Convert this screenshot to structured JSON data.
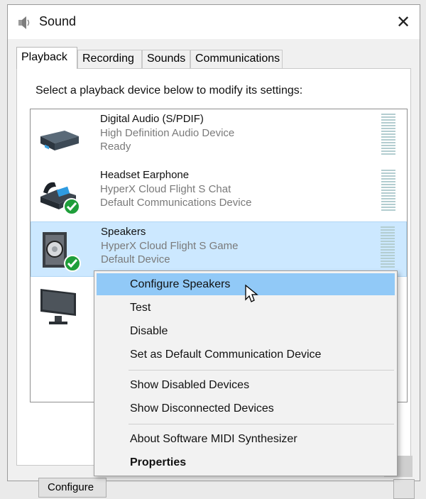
{
  "window": {
    "title": "Sound",
    "close_glyph": "✕"
  },
  "tabs": [
    {
      "label": "Playback",
      "active": true
    },
    {
      "label": "Recording",
      "active": false
    },
    {
      "label": "Sounds",
      "active": false
    },
    {
      "label": "Communications",
      "active": false
    }
  ],
  "instruction": "Select a playback device below to modify its settings:",
  "devices": [
    {
      "name": "Digital Audio (S/PDIF)",
      "driver": "High Definition Audio Device",
      "status": "Ready",
      "icon": "digital-audio-icon",
      "selected": false,
      "default_check": false
    },
    {
      "name": "Headset Earphone",
      "driver": "HyperX Cloud Flight S Chat",
      "status": "Default Communications Device",
      "icon": "headset-phone-icon",
      "selected": false,
      "default_check": true
    },
    {
      "name": "Speakers",
      "driver": "HyperX Cloud Flight S Game",
      "status": "Default Device",
      "icon": "speaker-icon",
      "selected": true,
      "default_check": true
    },
    {
      "name": "",
      "driver": "",
      "status": "",
      "icon": "monitor-icon",
      "selected": false,
      "default_check": false
    }
  ],
  "configure_button": "Configure",
  "context_menu": {
    "items": [
      {
        "label": "Configure Speakers",
        "highlight": true
      },
      {
        "label": "Test"
      },
      {
        "label": "Disable"
      },
      {
        "label": "Set as Default Communication Device"
      },
      {
        "label": "Show Disabled Devices"
      },
      {
        "label": "Show Disconnected Devices"
      },
      {
        "label": "About Software MIDI Synthesizer"
      },
      {
        "label": "Properties",
        "bold": true
      }
    ]
  },
  "colors": {
    "selection": "#cce8ff",
    "menu_highlight": "#91c9f7",
    "check_green": "#1f9e3a",
    "meter": "#b3cdd0"
  }
}
